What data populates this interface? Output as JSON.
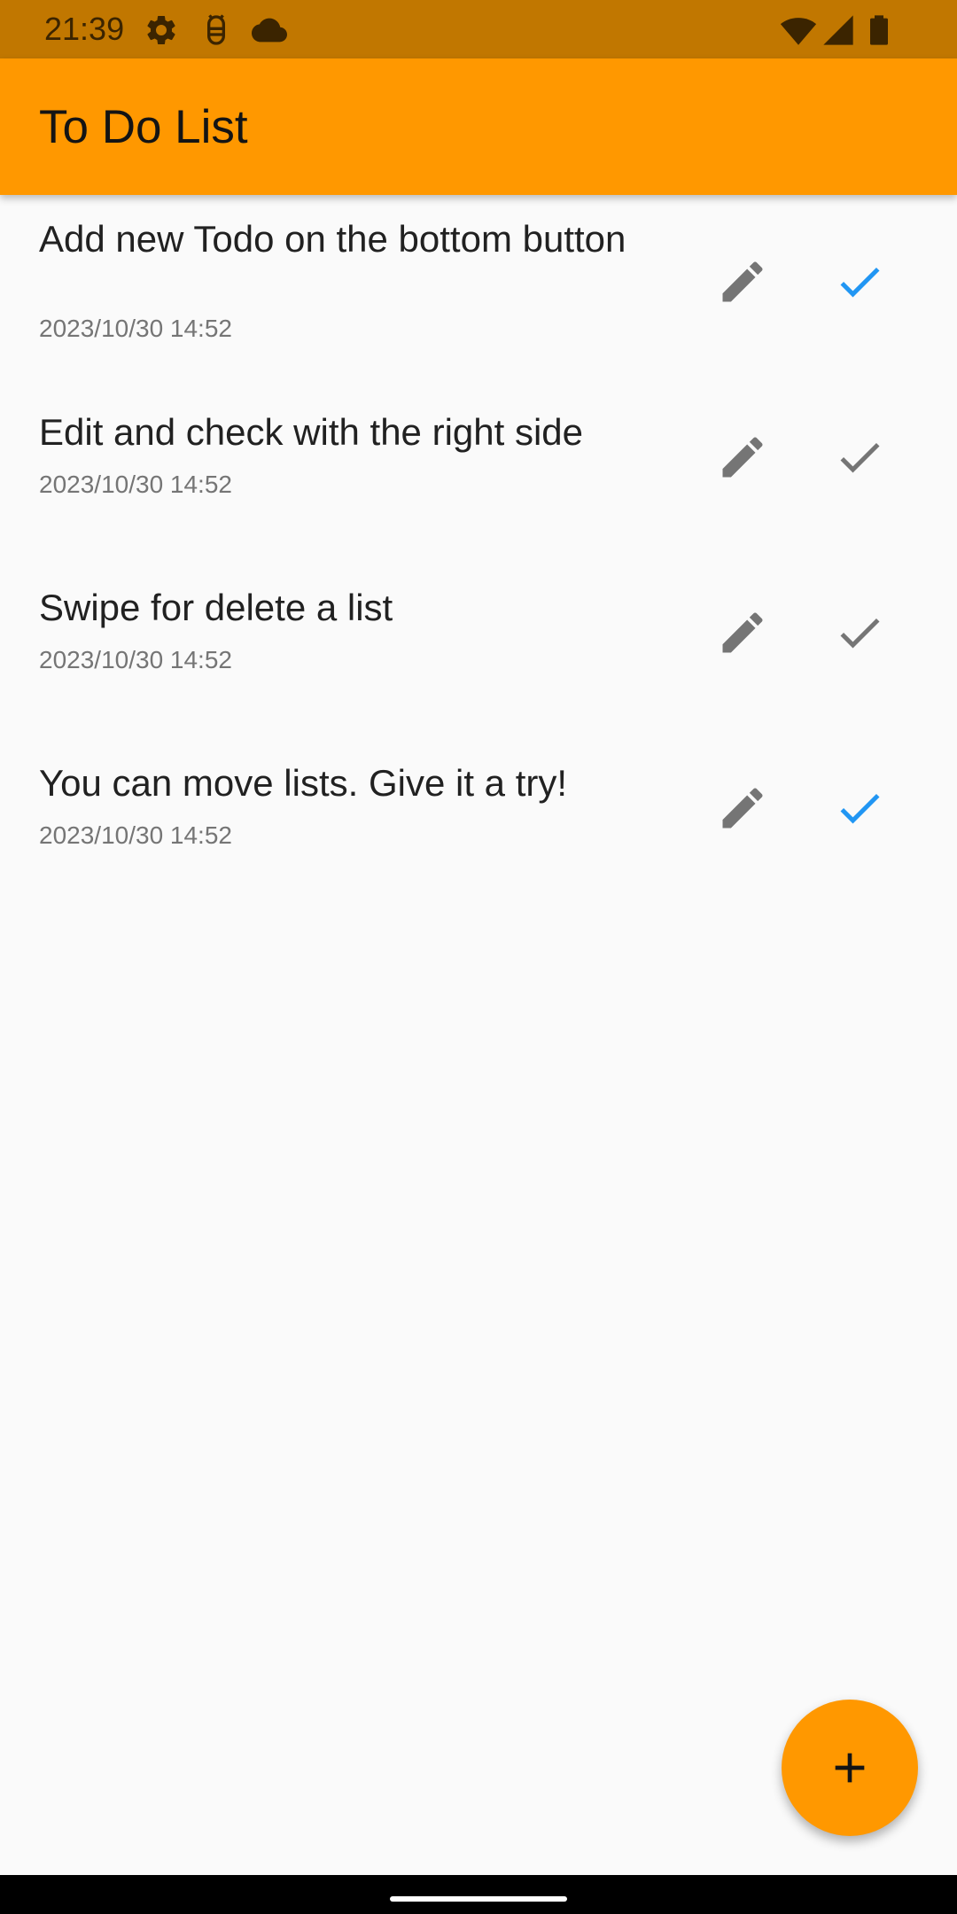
{
  "status_bar": {
    "time": "21:39",
    "left_icons": [
      "gear-icon",
      "android-debug-icon",
      "cloud-icon"
    ],
    "right_icons": [
      "wifi-icon",
      "cellular-signal-icon",
      "battery-icon"
    ]
  },
  "app_bar": {
    "title": "To Do List",
    "color": "#ff9800"
  },
  "todos": [
    {
      "title": "Add new Todo on the bottom button",
      "date": "2023/10/30 14:52",
      "checked": true
    },
    {
      "title": "Edit and check with the right side",
      "date": "2023/10/30 14:52",
      "checked": false
    },
    {
      "title": "Swipe for delete a list",
      "date": "2023/10/30 14:52",
      "checked": false
    },
    {
      "title": "You can move lists. Give it a try!",
      "date": "2023/10/30 14:52",
      "checked": true
    }
  ],
  "colors": {
    "checked": "#2196f3",
    "unchecked": "#757575",
    "edit_icon": "#757575"
  },
  "fab": {
    "icon": "plus-icon"
  }
}
